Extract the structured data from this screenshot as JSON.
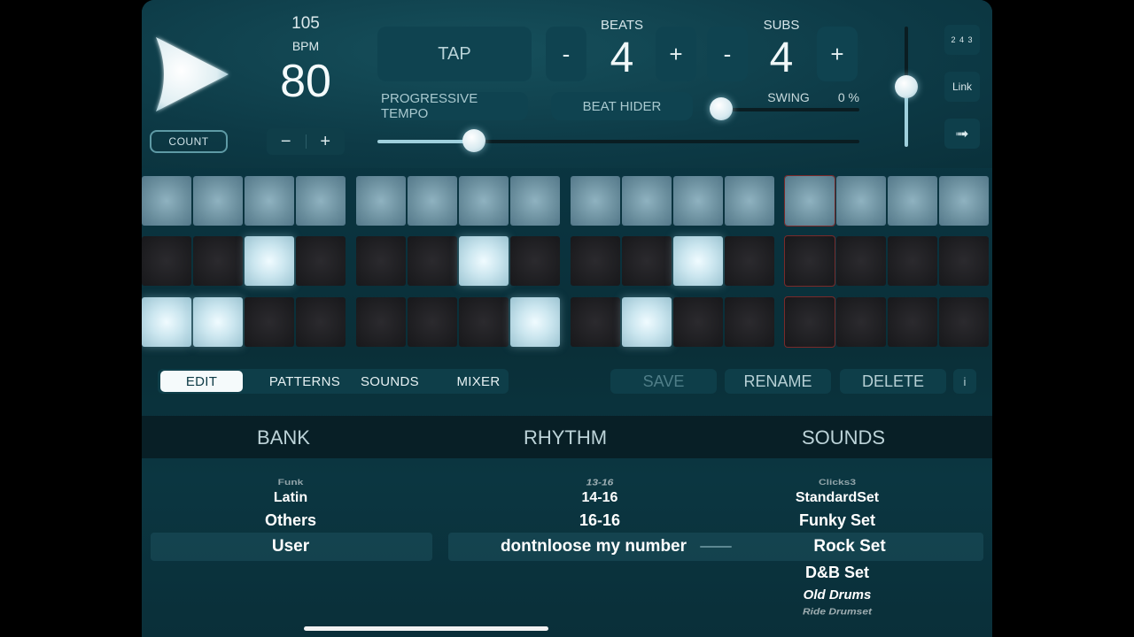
{
  "transport": {
    "count_label": "COUNT",
    "bpm_secondary": "105",
    "bpm_label": "BPM",
    "bpm_value": "80",
    "bpm_minus": "−",
    "bpm_plus": "+",
    "tap_label": "TAP",
    "progressive_label": "PROGRESSIVE TEMPO",
    "beat_hider_label": "BEAT HIDER",
    "tempo_slider_fraction": 0.2
  },
  "beats": {
    "label": "BEATS",
    "value": "4",
    "minus": "-",
    "plus": "+"
  },
  "subs": {
    "label": "SUBS",
    "value": "4",
    "minus": "-",
    "plus": "+"
  },
  "swing": {
    "label": "SWING",
    "value": "0 %",
    "fraction": 0.0
  },
  "volume_fraction": 0.5,
  "side_buttons": {
    "meter_icon_text": "2 4 3",
    "link_label": "Link",
    "arrow": "➟"
  },
  "grid": {
    "rows": [
      [
        1,
        1,
        1,
        1,
        1,
        1,
        1,
        1,
        1,
        1,
        1,
        1,
        1,
        1,
        1,
        1
      ],
      [
        0,
        0,
        1,
        0,
        0,
        0,
        1,
        0,
        0,
        0,
        1,
        0,
        0,
        0,
        0,
        0
      ],
      [
        1,
        1,
        0,
        0,
        0,
        0,
        0,
        1,
        0,
        1,
        0,
        0,
        0,
        0,
        0,
        0
      ]
    ],
    "current_step": 12
  },
  "tabs": {
    "edit": "EDIT",
    "patterns": "PATTERNS",
    "sounds": "SOUNDS",
    "mixer": "MIXER",
    "save": "SAVE",
    "rename": "RENAME",
    "delete": "DELETE",
    "info": "i"
  },
  "picker": {
    "bank_head": "BANK",
    "rhythm_head": "RHYTHM",
    "sounds_head": "SOUNDS",
    "bank": [
      "Funk",
      "Latin",
      "Others",
      "User"
    ],
    "rhythm": [
      "13-16",
      "14-16",
      "16-16",
      "dontnloose my number"
    ],
    "sounds": [
      "Clicks3",
      "StandardSet",
      "Funky Set",
      "Rock Set",
      "D&B Set",
      "Old Drums",
      "Ride Drumset"
    ]
  }
}
